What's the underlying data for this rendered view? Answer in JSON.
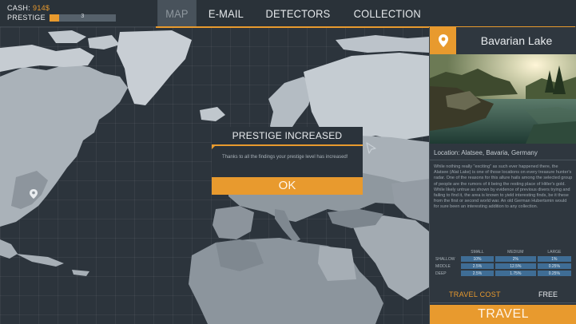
{
  "stats": {
    "cash_label": "CASH:",
    "cash_value": "914$",
    "prestige_label": "PRESTIGE",
    "prestige_level": "3",
    "prestige_progress": 0.15
  },
  "tabs": [
    {
      "label": "MAP",
      "active": true
    },
    {
      "label": "E-MAIL",
      "active": false
    },
    {
      "label": "DETECTORS",
      "active": false
    },
    {
      "label": "COLLECTION",
      "active": false
    }
  ],
  "location": {
    "title": "Bavarian Lake",
    "subtitle": "Location: Alatsee, Bavaria, Germany",
    "description": "While nothing really \"exciting\" as such ever happened there, the Alatsee (Alat Lake) is one of those locations on every treasure hunter's radar. One of the reasons for this allure hails among the selected group of people are the rumors of it being the resting place of Hitler's gold. While likely untrue as shown by evidence of previous divers trying and failing to find it, the area is known to yield interesting finds, be it these from the first or second world war. An old German Hubertsmin would for sure been an interesting addition to any collection."
  },
  "odds": {
    "columns": [
      "SMALL",
      "MEDIUM",
      "LARGE"
    ],
    "rows": [
      {
        "label": "SHALLOW",
        "values": [
          "10%",
          "2%",
          "1%"
        ]
      },
      {
        "label": "MIDDLE",
        "values": [
          "2.5%",
          "12.5%",
          "0.25%"
        ]
      },
      {
        "label": "DEEP",
        "values": [
          "2.5%",
          "1.75%",
          "0.25%"
        ]
      }
    ]
  },
  "travel": {
    "cost_label": "TRAVEL COST",
    "cost_value": "FREE",
    "button_label": "TRAVEL"
  },
  "dialog": {
    "title": "PRESTIGE INCREASED",
    "message": "Thanks to all the findings your prestige level has increased!",
    "ok_label": "OK"
  },
  "colors": {
    "accent": "#e89a2e",
    "background": "#2b333b",
    "land_light": "#c5ccd2",
    "land_mid": "#97a0a8",
    "land_dark": "#6f7982"
  },
  "icons": {
    "location_pin": "location-pin-icon",
    "map_marker": "map-marker-icon",
    "cursor": "cursor-arrow-icon"
  }
}
